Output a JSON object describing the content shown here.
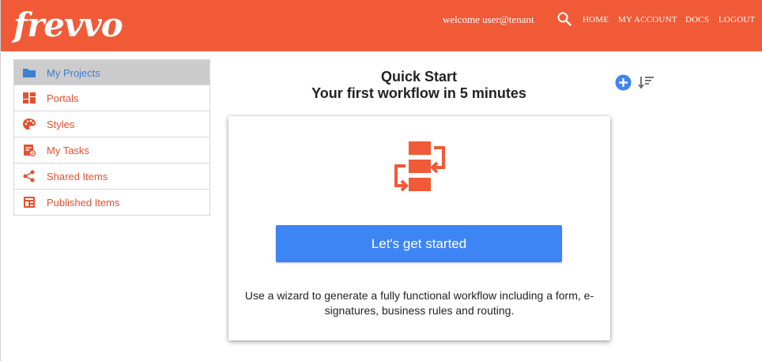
{
  "header": {
    "logo_text": "frevvo",
    "welcome": "welcome user@tenant",
    "search_icon": "search-icon",
    "nav": {
      "home": "HOME",
      "account": "MY ACCOUNT",
      "docs": "DOCS",
      "logout": "LOGOUT"
    },
    "bg_color": "#f05a37"
  },
  "sidebar": {
    "items": [
      {
        "label": "My Projects",
        "icon": "folder-icon",
        "active": true
      },
      {
        "label": "Portals",
        "icon": "dashboard-icon"
      },
      {
        "label": "Styles",
        "icon": "palette-icon"
      },
      {
        "label": "My Tasks",
        "icon": "tasks-icon"
      },
      {
        "label": "Shared Items",
        "icon": "share-icon"
      },
      {
        "label": "Published Items",
        "icon": "published-icon"
      }
    ]
  },
  "main": {
    "title": "Quick Start",
    "subtitle": "Your first workflow in 5 minutes",
    "card": {
      "button_label": "Let's get started",
      "description": "Use a wizard to generate a fully functional workflow including a form, e-signatures, business rules and routing."
    }
  },
  "colors": {
    "accent": "#f05a37",
    "primary_button": "#3d84f5",
    "active_link": "#3d7fd1"
  }
}
